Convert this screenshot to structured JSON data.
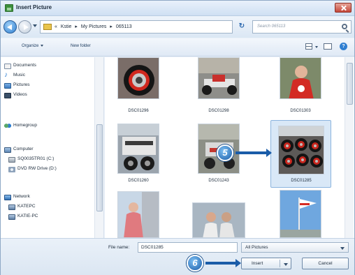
{
  "window": {
    "title": "Insert Picture"
  },
  "address": {
    "crumbs": [
      "«",
      "Kstie",
      "▸",
      "My Pictures",
      "▸",
      "065113"
    ],
    "search_placeholder": "Search 065113"
  },
  "toolbar": {
    "organize_label": "Organize",
    "new_folder_label": "New folder"
  },
  "sidebar": {
    "items": [
      {
        "label": "Documents",
        "icon": "documents-icon"
      },
      {
        "label": "Music",
        "icon": "music-icon"
      },
      {
        "label": "Pictures",
        "icon": "pictures-icon"
      },
      {
        "label": "Videos",
        "icon": "videos-icon"
      },
      {
        "label": "Homegroup",
        "icon": "homegroup-icon"
      },
      {
        "label": "Computer",
        "icon": "computer-icon"
      },
      {
        "label": "SQ0035TR01 (C:)",
        "icon": "drive-icon"
      },
      {
        "label": "DVD RW Drive (D:)",
        "icon": "dvd-drive-icon"
      },
      {
        "label": "Network",
        "icon": "network-icon"
      },
      {
        "label": "KATEPC",
        "icon": "pc-icon"
      },
      {
        "label": "KATIE-PC",
        "icon": "pc-icon"
      }
    ]
  },
  "files": [
    {
      "name": "DSC01296"
    },
    {
      "name": "DSC01298"
    },
    {
      "name": "DSC01303"
    },
    {
      "name": "DSC01260"
    },
    {
      "name": "DSC01243"
    },
    {
      "name": "DSC01285"
    },
    {
      "name": ""
    },
    {
      "name": ""
    },
    {
      "name": ""
    }
  ],
  "bottom": {
    "filename_label": "File name:",
    "filename_value": "DSC01285",
    "filetype_value": "All Pictures",
    "insert_label": "Insert",
    "cancel_label": "Cancel"
  },
  "callouts": {
    "step5": "5",
    "step6": "6"
  },
  "colors": {
    "accent": "#1a5ca8",
    "selection": "#d9e8f7"
  }
}
